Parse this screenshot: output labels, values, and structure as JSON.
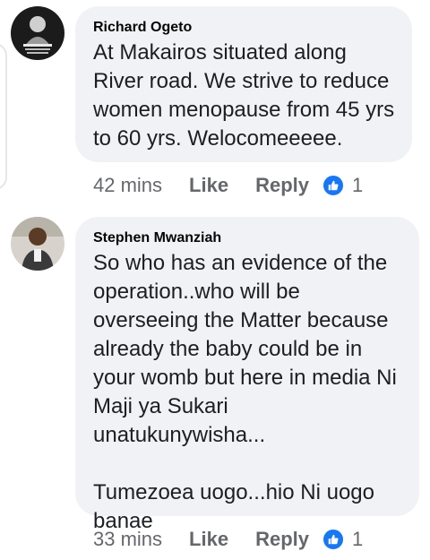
{
  "comments": [
    {
      "author": "Richard Ogeto",
      "text": "At  Makairos situated along\nRiver road. We strive to reduce\nwomen menopause from 45 yrs\nto 60 yrs. Welocomeeeee.",
      "time": "42 mins",
      "like_label": "Like",
      "reply_label": "Reply",
      "reaction_icon": "thumbs-up-icon",
      "reaction_count": "1"
    },
    {
      "author": "Stephen Mwanziah",
      "text": "So who has an evidence of the\noperation..who will be\noverseeing the Matter because\nalready the baby could be in\nyour womb but here in media Ni\nMaji ya Sukari unatukunywisha...\n\nTumezoea uogo...hio Ni uogo\nbanae",
      "time": "33 mins",
      "like_label": "Like",
      "reply_label": "Reply",
      "reaction_icon": "thumbs-up-icon",
      "reaction_count": "1"
    }
  ],
  "colors": {
    "bubble": "#f0f2f5",
    "meta_text": "#65676b",
    "like_blue": "#1877f2"
  }
}
